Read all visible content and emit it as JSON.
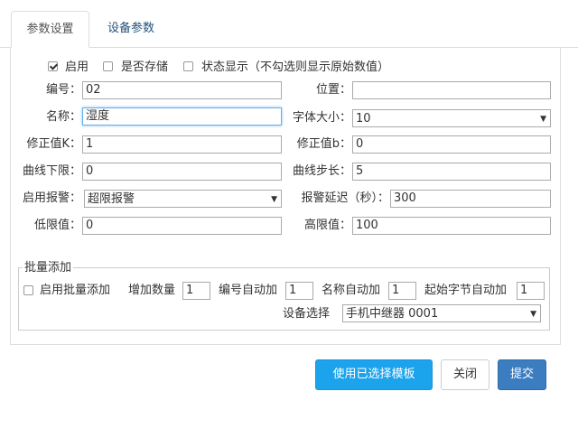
{
  "tabs": {
    "active": "参数设置",
    "inactive": "设备参数"
  },
  "options": {
    "enable_label": "启用",
    "enable_checked": true,
    "store_label": "是否存储",
    "status_label": "状态显示（不勾选则显示原始数值）"
  },
  "fields": {
    "number_label": "编号：",
    "number_value": "02",
    "position_label": "位置：",
    "position_value": "",
    "name_label": "名称：",
    "name_value": "湿度",
    "font_size_label": "字体大小：",
    "font_size_value": "10",
    "k_label": "修正值K：",
    "k_value": "1",
    "b_label": "修正值b：",
    "b_value": "0",
    "curve_lower_label": "曲线下限：",
    "curve_lower_value": "0",
    "curve_step_label": "曲线步长：",
    "curve_step_value": "5",
    "alarm_label": "启用报警：",
    "alarm_value": "超限报警",
    "alarm_delay_label": "报警延迟（秒）：",
    "alarm_delay_value": "300",
    "low_label": "低限值：",
    "low_value": "0",
    "high_label": "高限值：",
    "high_value": "100"
  },
  "batch": {
    "legend": "批量添加",
    "enable_label": "启用批量添加",
    "count_label": "增加数量",
    "count_value": "1",
    "num_auto_label": "编号自动加",
    "num_auto_value": "1",
    "name_auto_label": "名称自动加",
    "name_auto_value": "1",
    "byte_auto_label": "起始字节自动加",
    "byte_auto_value": "1",
    "device_label": "设备选择",
    "device_value": "手机中继器 0001"
  },
  "buttons": {
    "use_template": "使用已选择模板",
    "close": "关闭",
    "submit": "提交"
  }
}
